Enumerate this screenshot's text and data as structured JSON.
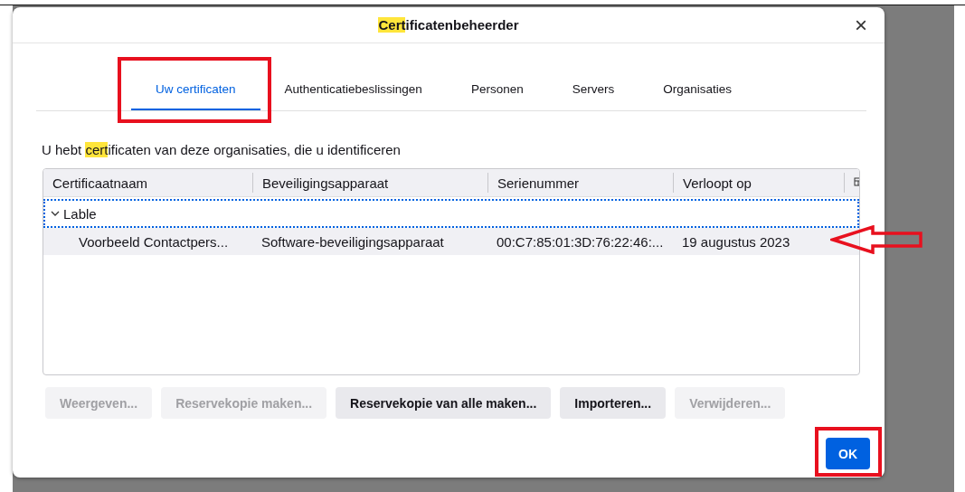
{
  "window": {
    "title": {
      "highlight": "Cert",
      "rest": "ificatenbeheerder"
    },
    "close": "×"
  },
  "tabs": [
    {
      "label": "Uw certificaten",
      "selected": true,
      "annotated": true
    },
    {
      "label": "Authenticatiebeslissingen",
      "selected": false,
      "annotated": false
    },
    {
      "label": "Personen",
      "selected": false,
      "annotated": false
    },
    {
      "label": "Servers",
      "selected": false,
      "annotated": false
    },
    {
      "label": "Organisaties",
      "selected": false,
      "annotated": false
    }
  ],
  "description": {
    "before": "U hebt ",
    "highlight": "cert",
    "after": "ificaten van deze organisaties, die u identificeren"
  },
  "table": {
    "columns": [
      "Certificaatnaam",
      "Beveiligingsapparaat",
      "Serienummer",
      "Verloopt op"
    ],
    "rows": [
      {
        "label": "Lable",
        "expanded": true,
        "focused": true,
        "children": [
          {
            "cells": [
              "Voorbeeld Contactpers...",
              "Software-beveiligingsapparaat",
              "00:C7:85:01:3D:76:22:46:...",
              "19 augustus 2023"
            ],
            "selected": true,
            "annotated": true
          }
        ]
      }
    ]
  },
  "buttons": [
    {
      "label": "Weergeven...",
      "disabled": true
    },
    {
      "label": "Reservekopie maken...",
      "disabled": true
    },
    {
      "label": "Reservekopie van alle maken...",
      "disabled": false
    },
    {
      "label": "Importeren...",
      "disabled": false
    },
    {
      "label": "Verwijderen...",
      "disabled": true
    }
  ],
  "ok_button": {
    "label": "OK",
    "annotated": true
  }
}
